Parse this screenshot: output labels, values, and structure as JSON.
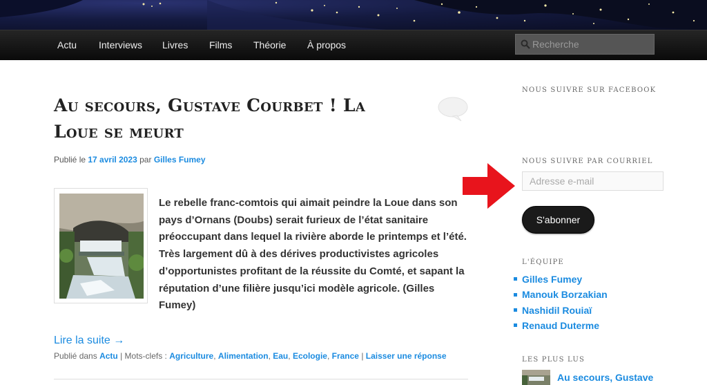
{
  "nav": {
    "items": [
      {
        "label": "Actu"
      },
      {
        "label": "Interviews"
      },
      {
        "label": "Livres"
      },
      {
        "label": "Films"
      },
      {
        "label": "Théorie"
      },
      {
        "label": "À propos"
      }
    ],
    "search_placeholder": "Recherche"
  },
  "post": {
    "title": "Au secours, Gustave Courbet ! La Loue se meurt",
    "meta_prefix": "Publié le",
    "date": "17 avril 2023",
    "by": "par",
    "author": "Gilles Fumey",
    "excerpt": "Le rebelle franc-comtois qui aimait peindre la Loue dans son pays d’Ornans (Doubs) serait furieux de l’état sanitaire préoccupant dans lequel la rivière aborde le printemps et l’été. Très largement dû à des dérives productivistes agricoles d’opportunistes profitant de la réussite du Comté, et sapant la réputation d’une filière jusqu’ici modèle agricole. (Gilles Fumey)",
    "read_more": "Lire la suite →",
    "posted_in": "Publié dans",
    "category": "Actu",
    "tags_label": "| Mots-clefs :",
    "tags": [
      "Agriculture",
      "Alimentation",
      "Eau",
      "Ecologie",
      "France"
    ],
    "reply_sep": "|",
    "reply": "Laisser une réponse"
  },
  "sidebar": {
    "facebook_title": "Nous suivre sur Facebook",
    "email_title": "Nous suivre par courriel",
    "email_placeholder": "Adresse e-mail",
    "subscribe_label": "S'abonner",
    "team_title": "L'équipe",
    "team": [
      "Gilles Fumey",
      "Manouk Borzakian",
      "Nashidil Rouiaï",
      "Renaud Duterme"
    ],
    "popular_title": "Les plus lus",
    "popular_item": "Au secours, Gustave"
  },
  "colors": {
    "link": "#1b8be0",
    "arrow": "#e8141c",
    "nav_bg": "#111111"
  }
}
